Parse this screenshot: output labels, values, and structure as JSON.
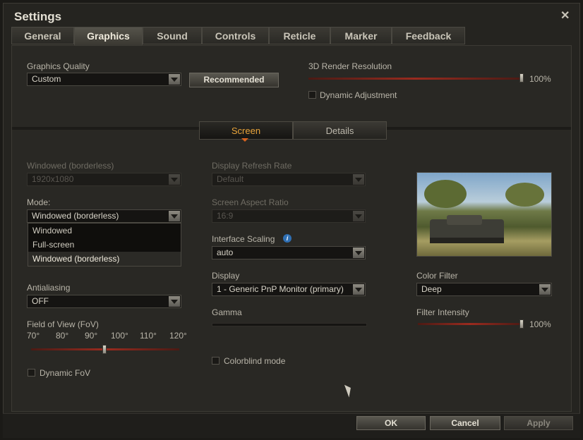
{
  "window": {
    "title": "Settings",
    "close_symbol": "✕"
  },
  "tabs": [
    "General",
    "Graphics",
    "Sound",
    "Controls",
    "Reticle",
    "Marker",
    "Feedback"
  ],
  "active_tab": "Graphics",
  "graphics_quality": {
    "label": "Graphics Quality",
    "value": "Custom",
    "recommended_label": "Recommended"
  },
  "render_resolution": {
    "label": "3D Render Resolution",
    "value_text": "100%",
    "level": 1.0,
    "dynamic_label": "Dynamic Adjustment",
    "dynamic_checked": false
  },
  "subtabs": [
    "Screen",
    "Details"
  ],
  "active_subtab": "Screen",
  "resolution": {
    "label": "Windowed (borderless)",
    "value": "1920x1080"
  },
  "mode": {
    "label": "Mode:",
    "value": "Windowed (borderless)",
    "options": [
      "Windowed",
      "Full-screen",
      "Windowed (borderless)"
    ]
  },
  "antialiasing": {
    "label": "Antialiasing",
    "value": "OFF"
  },
  "fov": {
    "label": "Field of View (FoV)",
    "ticks": [
      "70°",
      "80°",
      "90°",
      "100°",
      "110°",
      "120°"
    ],
    "value": 95,
    "dynamic_label": "Dynamic FoV",
    "dynamic_checked": false
  },
  "refresh_rate": {
    "label": "Display Refresh Rate",
    "value": "Default"
  },
  "aspect_ratio": {
    "label": "Screen Aspect Ratio",
    "value": "16:9"
  },
  "interface_scaling": {
    "label": "Interface Scaling",
    "value": "auto",
    "info_symbol": "i"
  },
  "display": {
    "label": "Display",
    "value": "1 - Generic PnP Monitor (primary)"
  },
  "gamma": {
    "label": "Gamma"
  },
  "colorblind": {
    "label": "Colorblind mode",
    "checked": false
  },
  "color_filter": {
    "label": "Color Filter",
    "value": "Deep"
  },
  "filter_intensity": {
    "label": "Filter Intensity",
    "value_text": "100%",
    "level": 1.0
  },
  "footer": {
    "ok": "OK",
    "cancel": "Cancel",
    "apply": "Apply"
  }
}
